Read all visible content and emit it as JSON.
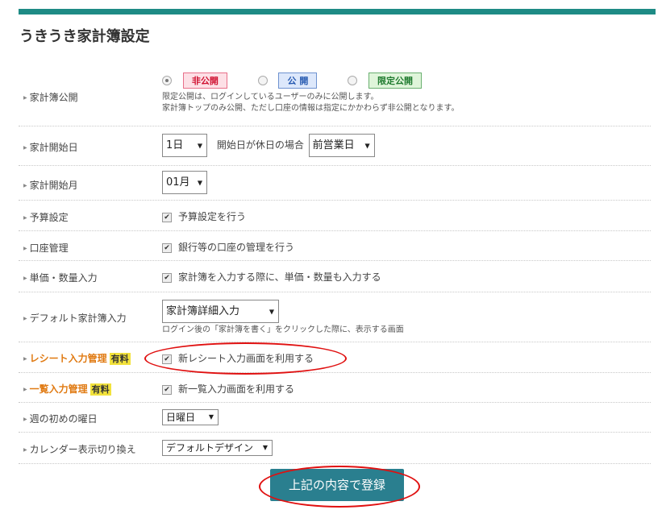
{
  "page": {
    "title": "うきうき家計簿設定"
  },
  "rows": {
    "visibility": {
      "label": "家計簿公開",
      "options": [
        "非公開",
        "公 開",
        "限定公開"
      ],
      "selected": "非公開",
      "note1": "限定公開は、ログインしているユーザーのみに公開します。",
      "note2": "家計簿トップのみ公開、ただし口座の情報は指定にかかわらず非公開となります。"
    },
    "start_day": {
      "label": "家計開始日",
      "value": "1日",
      "holiday_label": "開始日が休日の場合",
      "holiday_value": "前営業日"
    },
    "start_month": {
      "label": "家計開始月",
      "value": "01月"
    },
    "budget": {
      "label": "予算設定",
      "checkbox_label": "予算設定を行う",
      "checked": true
    },
    "account": {
      "label": "口座管理",
      "checkbox_label": "銀行等の口座の管理を行う",
      "checked": true
    },
    "unit_price": {
      "label": "単価・数量入力",
      "checkbox_label": "家計簿を入力する際に、単価・数量も入力する",
      "checked": true
    },
    "default_input": {
      "label": "デフォルト家計簿入力",
      "value": "家計簿詳細入力",
      "note": "ログイン後の「家計簿を書く」をクリックした際に、表示する画面"
    },
    "receipt": {
      "label": "レシート入力管理",
      "badge": "有料",
      "checkbox_label": "新レシート入力画面を利用する",
      "checked": true
    },
    "list_input": {
      "label": "一覧入力管理",
      "badge": "有料",
      "checkbox_label": "新一覧入力画面を利用する",
      "checked": true
    },
    "week_start": {
      "label": "週の初めの曜日",
      "value": "日曜日"
    },
    "calendar": {
      "label": "カレンダー表示切り換え",
      "value": "デフォルトデザイン"
    }
  },
  "submit_label": "上記の内容で登録",
  "colors": {
    "accent": "#1e8b85",
    "button": "#2a7f8f",
    "highlight_ring": "#e01010",
    "badge": "#f2e23c"
  }
}
